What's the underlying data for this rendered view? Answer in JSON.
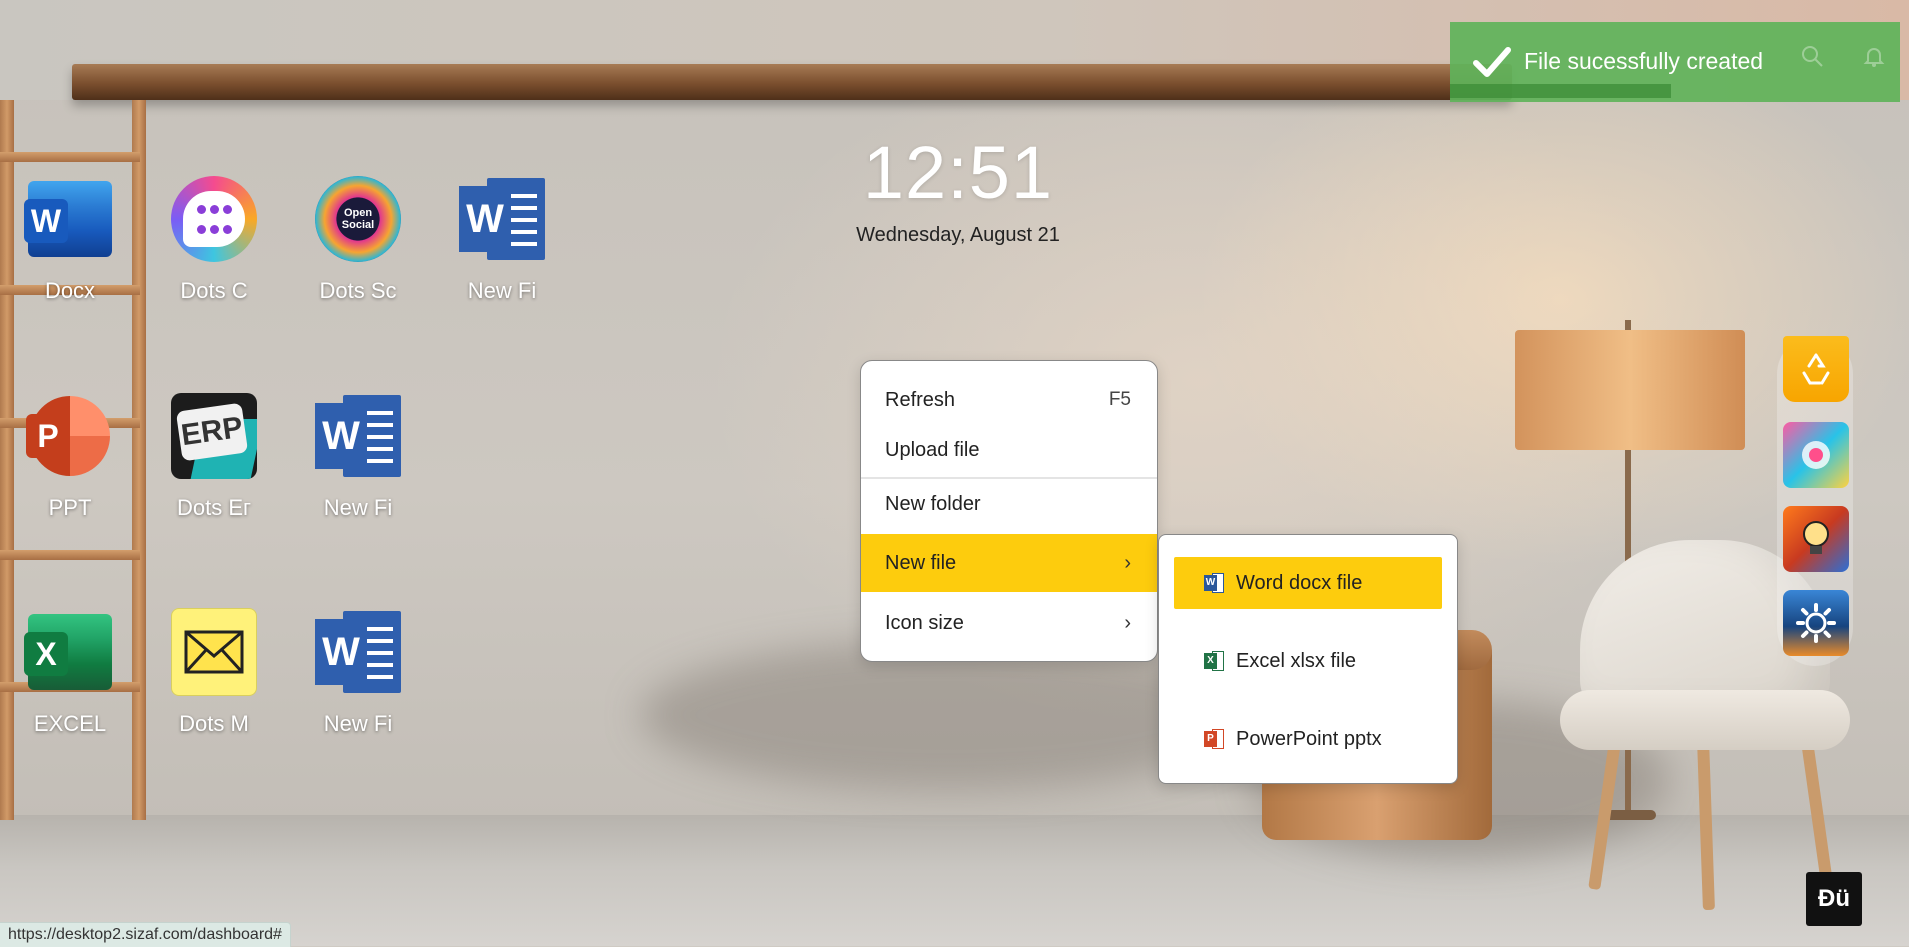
{
  "desktop": {
    "icons": [
      {
        "label": "Docx"
      },
      {
        "label": "Dots C"
      },
      {
        "label": "Dots Sс"
      },
      {
        "label": "New Fi"
      },
      {
        "label": "PPT"
      },
      {
        "label": "Dots Eг"
      },
      {
        "label": "New Fi"
      },
      {
        "label": "EXCEL"
      },
      {
        "label": "Dots M"
      },
      {
        "label": "New Fi"
      }
    ]
  },
  "clock": {
    "time": "12:51",
    "date": "Wednesday, August 21"
  },
  "context_menu": {
    "refresh_label": "Refresh",
    "refresh_shortcut": "F5",
    "upload_label": "Upload file",
    "new_folder_label": "New folder",
    "new_file_label": "New file",
    "icon_size_label": "Icon size"
  },
  "new_file_submenu": {
    "word_label": "Word docx file",
    "excel_label": "Excel xlsx file",
    "ppt_label": "PowerPoint pptx"
  },
  "toast": {
    "message": "File sucessfully created",
    "progress": 0.49,
    "color": "#60b35a"
  },
  "accent_color": "#fdcc0d",
  "status_bar": {
    "url": "https://desktop2.sizaf.com/dashboard#"
  },
  "corner_logo": {
    "text": "Đü"
  }
}
